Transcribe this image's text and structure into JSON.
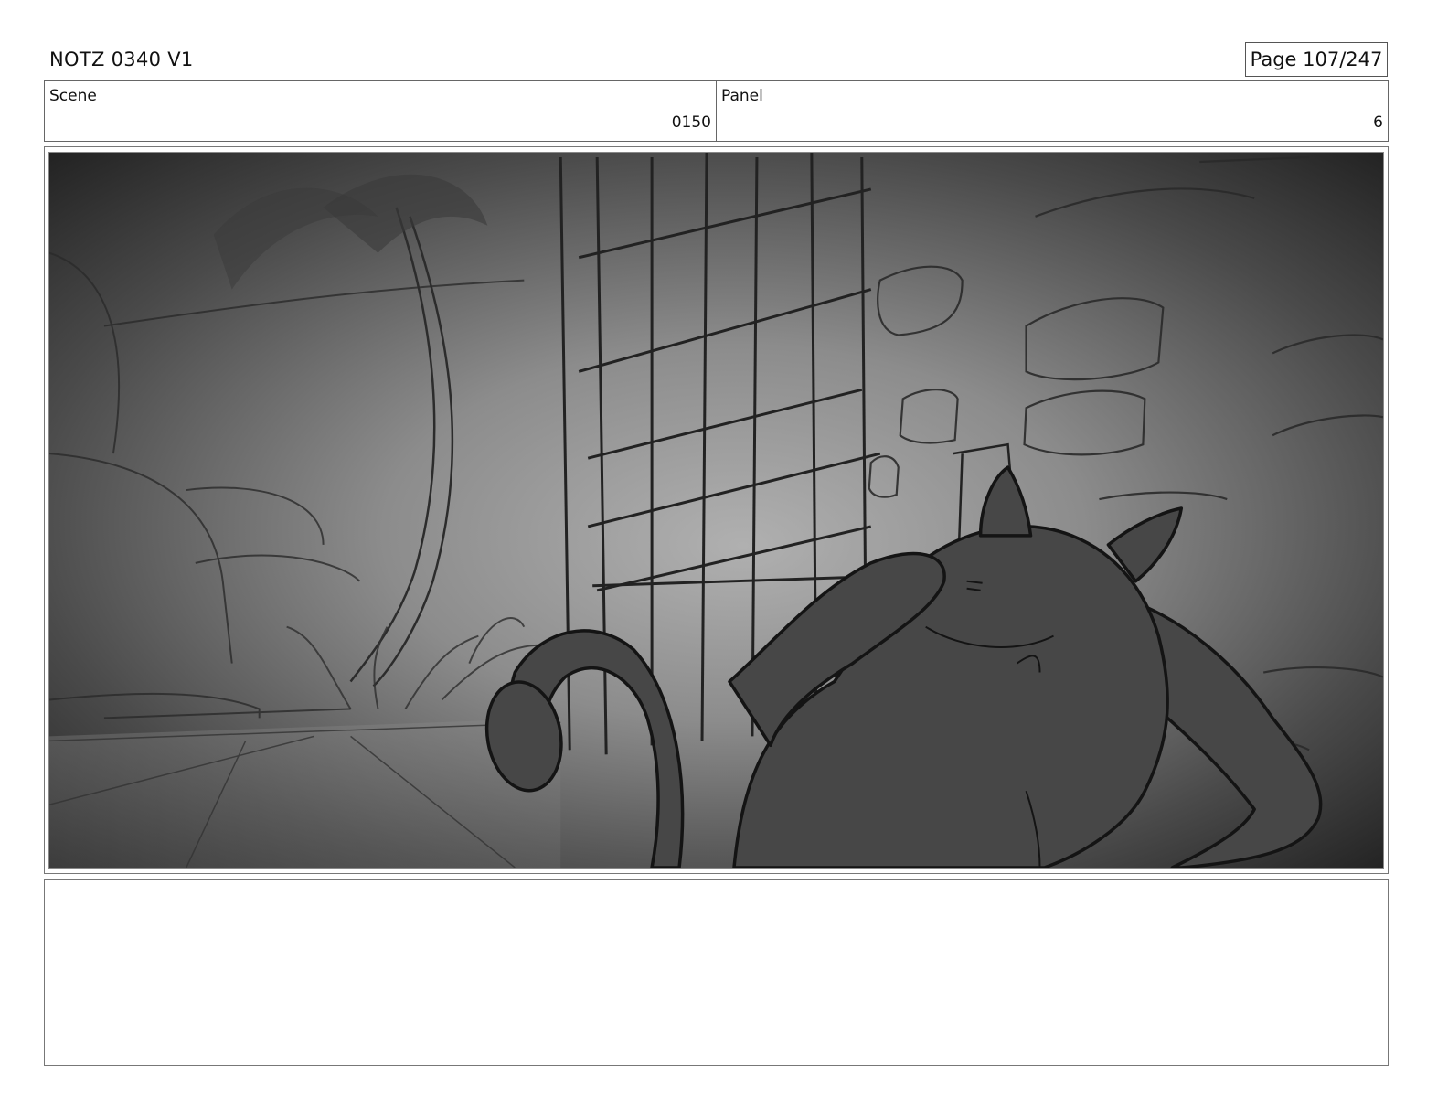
{
  "header": {
    "doc_title": "NOTZ 0340 V1",
    "page_label": "Page 107/247"
  },
  "info": {
    "scene_label": "Scene",
    "scene_value": "0150",
    "panel_label": "Panel",
    "panel_value": "6"
  },
  "artwork": {
    "description_icon": "storyboard-sketch-icon",
    "colors": {
      "light_center": "#a8a8a8",
      "dark_edge": "#1c1c1c",
      "character_fill": "#474747",
      "line": "#141414"
    }
  },
  "notes": {
    "text": ""
  }
}
